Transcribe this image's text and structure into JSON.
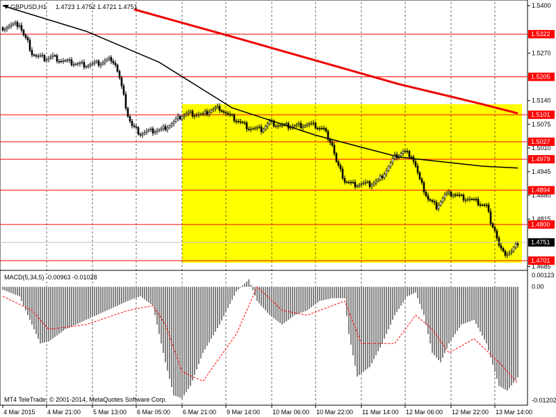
{
  "header": {
    "symbol": "GBPUSD,H1",
    "ohlc": "1.4723 1.4752 1.4721 1.4751"
  },
  "macd_header": "MACD(5,34,5) -0.00963 -0.01028",
  "copyright": "MT4 TeleTrade, © 2001-2014, MetaQuotes Software Corp.",
  "colors": {
    "candle": "#000000",
    "zone": "#ffff00",
    "level_line": "#ff0000",
    "ma_fast": "#000000",
    "ma_slow": "#ee0000",
    "hist": "#808080",
    "signal": "#ff0000",
    "grid": "#000000",
    "current_price_tag": "#000000"
  },
  "chart_data": [
    {
      "type": "candlestick",
      "title": "GBPUSD,H1",
      "y_ticks": [
        "1.5400",
        "1.5270",
        "1.5140",
        "1.5075",
        "1.5010",
        "1.4945",
        "1.4880",
        "1.4815",
        "1.4685"
      ],
      "x_ticks": [
        "4 Mar 2015",
        "4 Mar 21:00",
        "5 Mar 13:00",
        "6 Mar 05:00",
        "6 Mar 21:00",
        "9 Mar 14:00",
        "10 Mar 06:00",
        "10 Mar 22:00",
        "11 Mar 14:00",
        "12 Mar 06:00",
        "12 Mar 22:00",
        "13 Mar 14:00"
      ],
      "ylim": [
        1.468,
        1.541
      ],
      "grid": true,
      "levels": [
        "1.5322",
        "1.5205",
        "1.5101",
        "1.5027",
        "1.4979",
        "1.4894",
        "1.4800",
        "1.4701"
      ],
      "current_price": "1.4751",
      "zone": {
        "from_label": "6 Mar 21:00",
        "y_top": 1.513,
        "y_bottom": 1.4695
      },
      "series": [
        {
          "kind": "ohlc_path",
          "close_path": [
            [
              0,
              1.534
            ],
            [
              4,
              1.5345
            ],
            [
              8,
              1.535
            ],
            [
              10,
              1.5318
            ],
            [
              12,
              1.53
            ],
            [
              14,
              1.527
            ],
            [
              16,
              1.5262
            ],
            [
              20,
              1.5255
            ],
            [
              24,
              1.526
            ],
            [
              28,
              1.525
            ],
            [
              32,
              1.5245
            ],
            [
              36,
              1.524
            ],
            [
              40,
              1.5238
            ],
            [
              44,
              1.524
            ],
            [
              48,
              1.5245
            ],
            [
              52,
              1.5255
            ],
            [
              54,
              1.524
            ],
            [
              56,
              1.52
            ],
            [
              58,
              1.515
            ],
            [
              60,
              1.51
            ],
            [
              62,
              1.507
            ],
            [
              66,
              1.505
            ],
            [
              70,
              1.5055
            ],
            [
              76,
              1.506
            ],
            [
              82,
              1.508
            ],
            [
              86,
              1.51
            ],
            [
              90,
              1.5105
            ],
            [
              96,
              1.51
            ],
            [
              100,
              1.5115
            ],
            [
              104,
              1.512
            ],
            [
              108,
              1.51
            ],
            [
              114,
              1.508
            ],
            [
              118,
              1.5065
            ],
            [
              124,
              1.506
            ],
            [
              128,
              1.508
            ],
            [
              134,
              1.507
            ],
            [
              140,
              1.507
            ],
            [
              146,
              1.5075
            ],
            [
              150,
              1.507
            ],
            [
              154,
              1.506
            ],
            [
              158,
              1.502
            ],
            [
              160,
              1.497
            ],
            [
              164,
              1.492
            ],
            [
              168,
              1.491
            ],
            [
              172,
              1.4912
            ],
            [
              176,
              1.491
            ],
            [
              180,
              1.492
            ],
            [
              184,
              1.495
            ],
            [
              188,
              1.4985
            ],
            [
              192,
              1.5
            ],
            [
              196,
              1.499
            ],
            [
              198,
              1.496
            ],
            [
              200,
              1.492
            ],
            [
              204,
              1.487
            ],
            [
              208,
              1.485
            ],
            [
              212,
              1.488
            ],
            [
              216,
              1.4885
            ],
            [
              220,
              1.4875
            ],
            [
              224,
              1.487
            ],
            [
              228,
              1.486
            ],
            [
              232,
              1.485
            ],
            [
              234,
              1.481
            ],
            [
              236,
              1.4785
            ],
            [
              238,
              1.474
            ],
            [
              240,
              1.472
            ],
            [
              244,
              1.4725
            ],
            [
              247,
              1.4751
            ]
          ],
          "n_bars": 248
        }
      ],
      "ma_fast": [
        [
          0,
          1.54
        ],
        [
          40,
          1.533
        ],
        [
          75,
          1.5245
        ],
        [
          110,
          1.512
        ],
        [
          150,
          1.5045
        ],
        [
          190,
          1.4985
        ],
        [
          230,
          1.496
        ],
        [
          247,
          1.4955
        ]
      ],
      "ma_slow": [
        [
          63,
          1.539
        ],
        [
          110,
          1.5315
        ],
        [
          150,
          1.525
        ],
        [
          190,
          1.5185
        ],
        [
          230,
          1.513
        ],
        [
          247,
          1.5105
        ]
      ]
    },
    {
      "type": "bar",
      "title": "MACD(5,34,5) -0.00963 -0.01028",
      "y_ticks": [
        "0.00123",
        "0.00",
        "-0.01202"
      ],
      "ylim": [
        -0.01202,
        0.00123
      ],
      "hist_path": [
        [
          0,
          -0.0003
        ],
        [
          8,
          -0.001
        ],
        [
          14,
          -0.004
        ],
        [
          18,
          -0.006
        ],
        [
          22,
          -0.0058
        ],
        [
          30,
          -0.0045
        ],
        [
          40,
          -0.0035
        ],
        [
          50,
          -0.0025
        ],
        [
          60,
          -0.0015
        ],
        [
          66,
          -0.001
        ],
        [
          72,
          -0.002
        ],
        [
          78,
          -0.008
        ],
        [
          82,
          -0.0115
        ],
        [
          86,
          -0.0118
        ],
        [
          90,
          -0.0105
        ],
        [
          96,
          -0.007
        ],
        [
          104,
          -0.004
        ],
        [
          112,
          -0.0005
        ],
        [
          118,
          0.0008
        ],
        [
          122,
          -0.0015
        ],
        [
          128,
          -0.003
        ],
        [
          134,
          -0.004
        ],
        [
          140,
          -0.003
        ],
        [
          146,
          -0.0025
        ],
        [
          152,
          -0.0015
        ],
        [
          158,
          -0.0012
        ],
        [
          164,
          -0.0012
        ],
        [
          166,
          -0.005
        ],
        [
          170,
          -0.0095
        ],
        [
          176,
          -0.0085
        ],
        [
          182,
          -0.006
        ],
        [
          188,
          -0.003
        ],
        [
          194,
          -0.001
        ],
        [
          198,
          -0.0006
        ],
        [
          202,
          -0.003
        ],
        [
          206,
          -0.007
        ],
        [
          210,
          -0.008
        ],
        [
          214,
          -0.006
        ],
        [
          220,
          -0.004
        ],
        [
          226,
          -0.0035
        ],
        [
          232,
          -0.006
        ],
        [
          238,
          -0.0105
        ],
        [
          242,
          -0.011
        ],
        [
          247,
          -0.0096
        ]
      ],
      "signal_path": [
        [
          0,
          -0.001
        ],
        [
          14,
          -0.0025
        ],
        [
          22,
          -0.0045
        ],
        [
          40,
          -0.004
        ],
        [
          60,
          -0.0025
        ],
        [
          72,
          -0.002
        ],
        [
          78,
          -0.004
        ],
        [
          86,
          -0.009
        ],
        [
          96,
          -0.01
        ],
        [
          112,
          -0.005
        ],
        [
          122,
          0.0
        ],
        [
          134,
          -0.0025
        ],
        [
          146,
          -0.003
        ],
        [
          164,
          -0.0015
        ],
        [
          172,
          -0.006
        ],
        [
          188,
          -0.006
        ],
        [
          198,
          -0.003
        ],
        [
          206,
          -0.0045
        ],
        [
          214,
          -0.007
        ],
        [
          226,
          -0.0055
        ],
        [
          238,
          -0.008
        ],
        [
          247,
          -0.0102
        ]
      ]
    }
  ]
}
